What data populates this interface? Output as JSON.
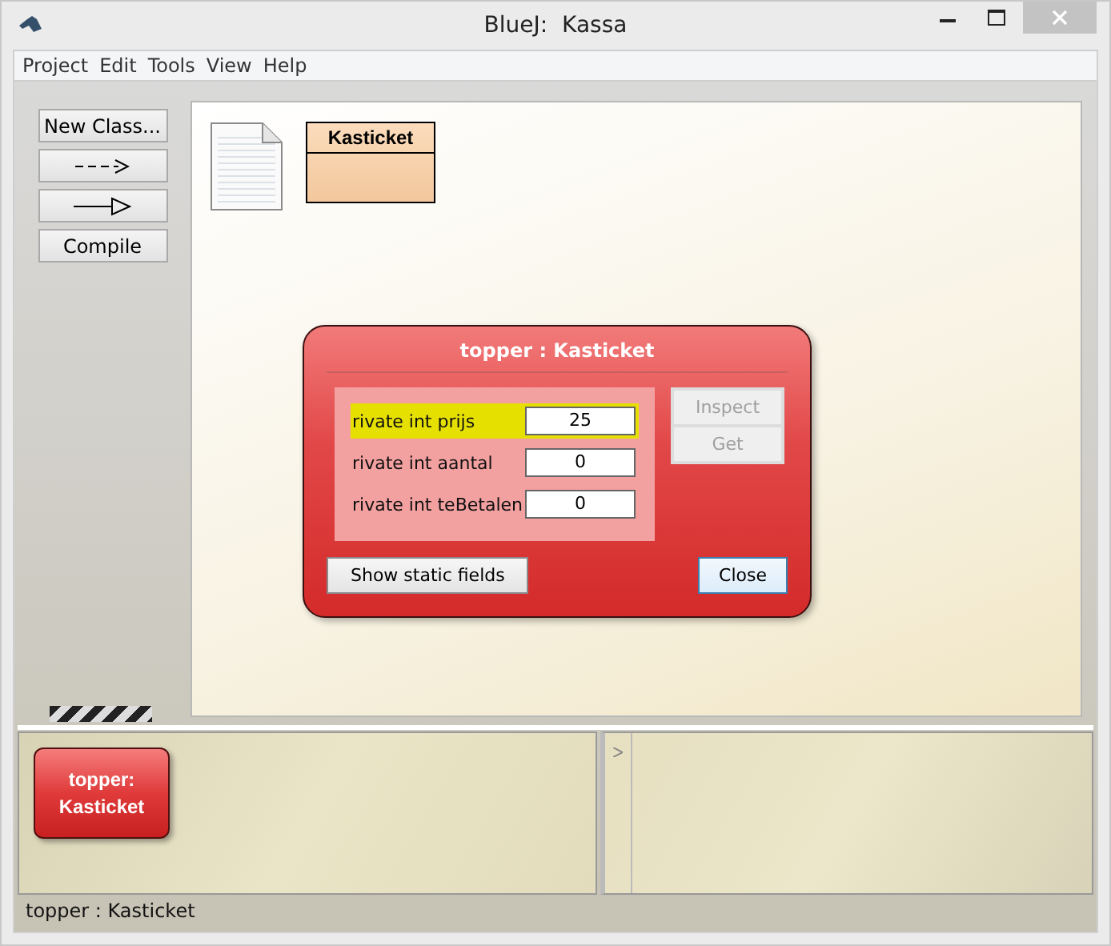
{
  "window": {
    "title": "BlueJ:  Kassa"
  },
  "menu": [
    "Project",
    "Edit",
    "Tools",
    "View",
    "Help"
  ],
  "toolbar": [
    {
      "kind": "text",
      "label": "New Class..."
    },
    {
      "kind": "dashed-arrow"
    },
    {
      "kind": "solid-arrow"
    },
    {
      "kind": "text",
      "label": "Compile"
    }
  ],
  "diagram": {
    "classes": [
      {
        "name": "Kasticket"
      }
    ]
  },
  "inspector": {
    "title": "topper : Kasticket",
    "fields": [
      {
        "label": "rivate int prijs",
        "value": "25",
        "selected": true
      },
      {
        "label": "rivate int aantal",
        "value": "0",
        "selected": false
      },
      {
        "label": "rivate int teBetalen",
        "value": "0",
        "selected": false
      }
    ],
    "side_buttons": [
      {
        "label": "Inspect",
        "disabled": true
      },
      {
        "label": "Get",
        "disabled": true
      }
    ],
    "buttons": [
      {
        "label": "Show static fields",
        "default": false
      },
      {
        "label": "Close",
        "default": true
      }
    ]
  },
  "object_bench": [
    {
      "lines": [
        "topper:",
        "Kasticket"
      ]
    }
  ],
  "status_bar": "topper : Kasticket"
}
